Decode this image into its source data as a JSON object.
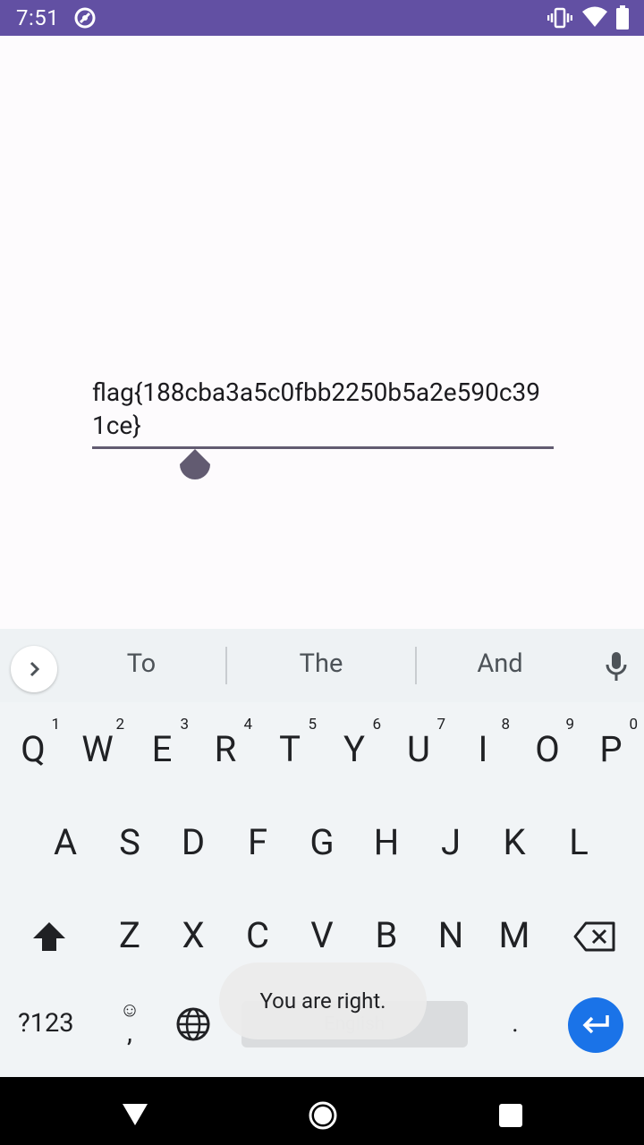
{
  "status_bar": {
    "time": "7:51"
  },
  "app": {
    "flag_text": "flag{188cba3a5c0fbb2250b5a2e590c391ce}"
  },
  "keyboard": {
    "suggestions": [
      "To",
      "The",
      "And"
    ],
    "row1": [
      {
        "key": "Q",
        "hint": "1"
      },
      {
        "key": "W",
        "hint": "2"
      },
      {
        "key": "E",
        "hint": "3"
      },
      {
        "key": "R",
        "hint": "4"
      },
      {
        "key": "T",
        "hint": "5"
      },
      {
        "key": "Y",
        "hint": "6"
      },
      {
        "key": "U",
        "hint": "7"
      },
      {
        "key": "I",
        "hint": "8"
      },
      {
        "key": "O",
        "hint": "9"
      },
      {
        "key": "P",
        "hint": "0"
      }
    ],
    "row2": [
      "A",
      "S",
      "D",
      "F",
      "G",
      "H",
      "J",
      "K",
      "L"
    ],
    "row3": [
      "Z",
      "X",
      "C",
      "V",
      "B",
      "N",
      "M"
    ],
    "symbols_label": "?123",
    "emoji_top": "☺",
    "emoji_bottom": ",",
    "space_label": "English",
    "period_label": ".",
    "accent_color": "#1a73e8"
  },
  "toast": {
    "message": "You are right."
  },
  "icons": {
    "status": [
      "notification-icon",
      "vibrate-icon",
      "wifi-icon",
      "battery-icon"
    ],
    "keyboard": [
      "chevron-right-icon",
      "mic-icon",
      "shift-icon",
      "backspace-icon",
      "globe-icon",
      "enter-icon"
    ],
    "nav": [
      "back-icon",
      "home-icon",
      "recents-icon"
    ]
  }
}
